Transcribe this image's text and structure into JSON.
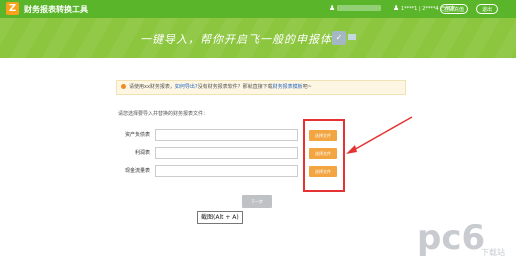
{
  "header": {
    "logo_glyph": "Z",
    "app_title": "财务报表转换工具",
    "user_icon": "user-icon",
    "user_id_text": "1****1 | 2****4 已绑定",
    "recharge_label": "立即充值",
    "logout_label": "退出"
  },
  "banner": {
    "slogan": "一键导入，帮你开启飞一般的申报体验"
  },
  "notice": {
    "text_before": "请使用xx财务报表，",
    "link1": "如何导出?",
    "text_middle": "没有财务报表软件？那就直接下载",
    "link2": "财务报表模板",
    "text_after": "吧~"
  },
  "form": {
    "instruction": "请您选择要导入并替换的财务报表文件：",
    "rows": [
      {
        "label": "资产负债表",
        "value": "",
        "button": "选择文件"
      },
      {
        "label": "利润表",
        "value": "",
        "button": "选择文件"
      },
      {
        "label": "现金流量表",
        "value": "",
        "button": "选择文件"
      }
    ],
    "next_label": "下一步"
  },
  "tooltip": {
    "text": "截图(Alt + A)"
  },
  "watermark": {
    "text": "pc6",
    "subtext": "下载站"
  },
  "colors": {
    "header_green": "#5ab52a",
    "banner_green": "#8bc63e",
    "accent_orange": "#f3a541",
    "highlight_red": "#e53333"
  }
}
